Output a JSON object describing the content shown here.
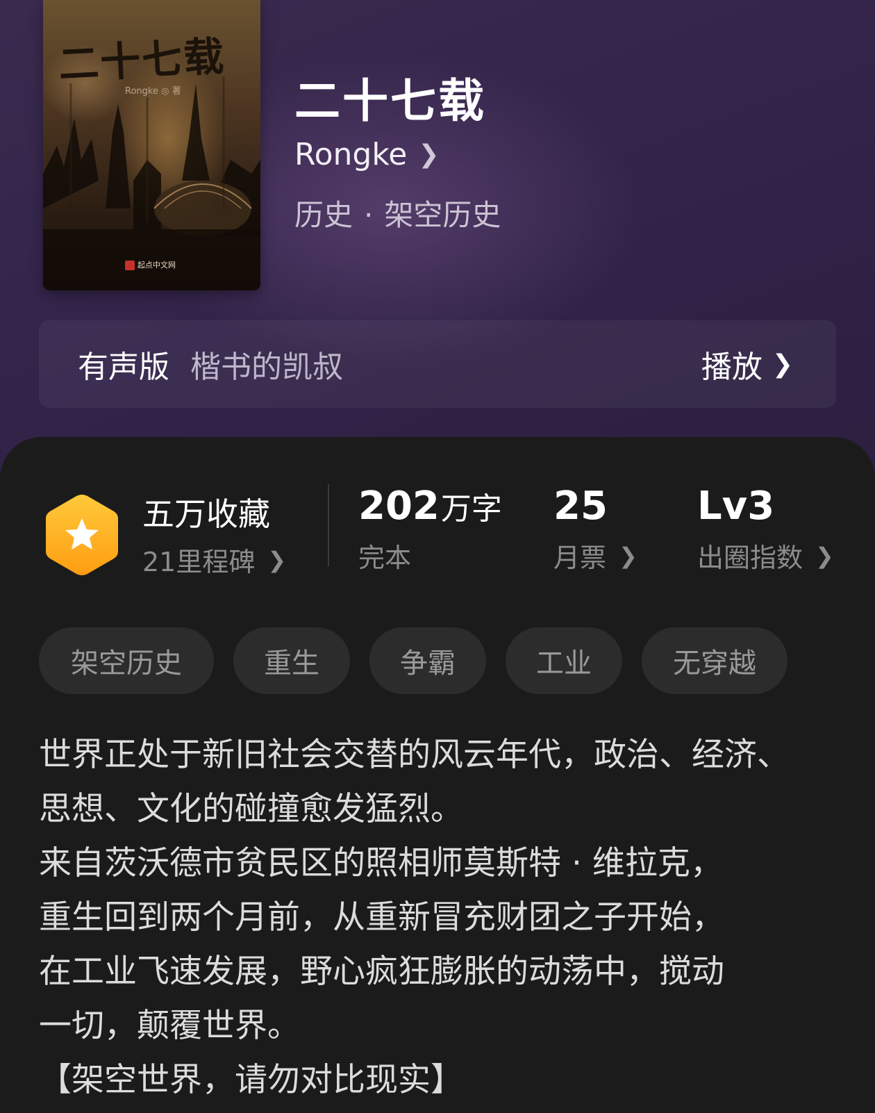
{
  "book": {
    "title": "二十七载",
    "author": "Rongke",
    "genre_main": "历史",
    "genre_separator": "·",
    "genre_sub": "架空历史",
    "cover": {
      "title_text": "二十七载",
      "author_text": "Rongke ◎ 著",
      "publisher_text": "起点中文网"
    }
  },
  "audio": {
    "label": "有声版",
    "narrator": "楷书的凯叔",
    "play_label": "播放"
  },
  "stats": {
    "collection": {
      "title": "五万收藏",
      "sub": "21里程碑"
    },
    "words": {
      "value": "202",
      "unit": "万字",
      "sub": "完本"
    },
    "tickets": {
      "value": "25",
      "sub": "月票"
    },
    "level": {
      "value": "Lv3",
      "sub": "出圈指数"
    }
  },
  "tags": [
    "架空历史",
    "重生",
    "争霸",
    "工业",
    "无穿越"
  ],
  "intro": [
    "世界正处于新旧社会交替的风云年代，政治、经济、",
    "思想、文化的碰撞愈发猛烈。",
    "来自茨沃德市贫民区的照相师莫斯特 · 维拉克，",
    "重生回到两个月前，从重新冒充财团之子开始，",
    "在工业飞速发展，野心疯狂膨胀的动荡中，搅动",
    "一切，颠覆世界。",
    "【架空世界，请勿对比现实】"
  ],
  "colors": {
    "header_purple": "#33244a",
    "panel_dark": "#1b1b1b",
    "badge_orange": "#ffb21f",
    "tag_bg": "#2c2c2c"
  },
  "icons": {
    "badge": "star-hexagon-icon",
    "chevron": "chevron-right-icon"
  }
}
